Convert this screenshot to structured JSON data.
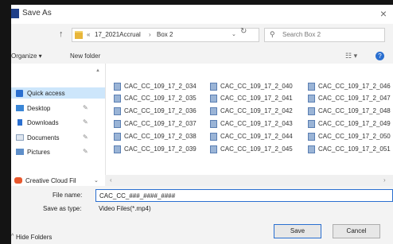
{
  "window": {
    "title": "Save As"
  },
  "address": {
    "crumbs": [
      "17_2021Accrual",
      "Box 2"
    ],
    "search_placeholder": "Search Box 2"
  },
  "toolbar": {
    "organize_label": "Organize ▾",
    "new_folder_label": "New folder"
  },
  "nav": {
    "items": [
      {
        "label": "Quick access",
        "pinned": false
      },
      {
        "label": "Desktop",
        "pinned": true
      },
      {
        "label": "Downloads",
        "pinned": true
      },
      {
        "label": "Documents",
        "pinned": true
      },
      {
        "label": "Pictures",
        "pinned": true
      }
    ],
    "cloud_label": "Creative Cloud Fil"
  },
  "files": {
    "col1": [
      "CAC_CC_109_17_2_034",
      "CAC_CC_109_17_2_035",
      "CAC_CC_109_17_2_036",
      "CAC_CC_109_17_2_037",
      "CAC_CC_109_17_2_038",
      "CAC_CC_109_17_2_039"
    ],
    "col2": [
      "CAC_CC_109_17_2_040",
      "CAC_CC_109_17_2_041",
      "CAC_CC_109_17_2_042",
      "CAC_CC_109_17_2_043",
      "CAC_CC_109_17_2_044",
      "CAC_CC_109_17_2_045"
    ],
    "col3": [
      "CAC_CC_109_17_2_046",
      "CAC_CC_109_17_2_047",
      "CAC_CC_109_17_2_048",
      "CAC_CC_109_17_2_049",
      "CAC_CC_109_17_2_050",
      "CAC_CC_109_17_2_051"
    ]
  },
  "form": {
    "filename_label": "File name:",
    "filename_value": "CAC_CC_###_####_####",
    "type_label": "Save as type:",
    "type_value": "Video Files(*.mp4)",
    "hide_folders": "Hide Folders",
    "save_label": "Save",
    "cancel_label": "Cancel"
  }
}
